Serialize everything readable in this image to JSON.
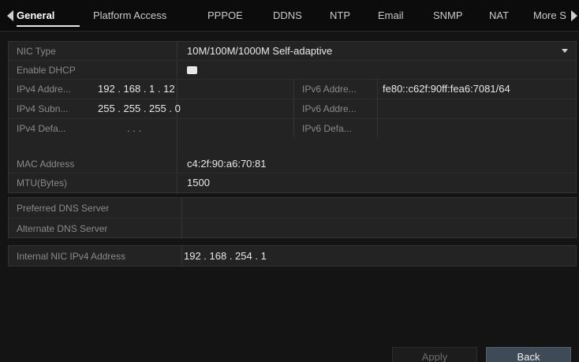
{
  "tabs": [
    "General",
    "Platform Access",
    "PPPOE",
    "DDNS",
    "NTP",
    "Email",
    "SNMP",
    "NAT",
    "More S"
  ],
  "active_tab": "General",
  "fields": {
    "nic_type": {
      "label": "NIC Type",
      "value": "10M/100M/1000M Self-adaptive"
    },
    "enable_dhcp": {
      "label": "Enable DHCP",
      "checked": true
    },
    "ipv4_address": {
      "label": "IPv4 Addre...",
      "value": "192 . 168 . 1    . 12"
    },
    "ipv4_subnet": {
      "label": "IPv4 Subn...",
      "value": "255 . 255 . 255 . 0"
    },
    "ipv4_gateway": {
      "label": "IPv4 Defa...",
      "value": ".    .    ."
    },
    "ipv6_address1": {
      "label": "IPv6 Addre...",
      "value": "fe80::c62f:90ff:fea6:7081/64"
    },
    "ipv6_address2": {
      "label": "IPv6 Addre...",
      "value": ""
    },
    "ipv6_gateway": {
      "label": "IPv6 Defa...",
      "value": ""
    },
    "mac_address": {
      "label": "MAC Address",
      "value": "c4:2f:90:a6:70:81"
    },
    "mtu": {
      "label": "MTU(Bytes)",
      "value": "1500"
    },
    "preferred_dns": {
      "label": "Preferred DNS Server",
      "value": ""
    },
    "alternate_dns": {
      "label": "Alternate DNS Server",
      "value": ""
    },
    "internal_nic": {
      "label": "Internal NIC IPv4 Address",
      "value": "192 . 168 . 254 . 1"
    }
  },
  "buttons": {
    "apply": "Apply",
    "back": "Back"
  }
}
